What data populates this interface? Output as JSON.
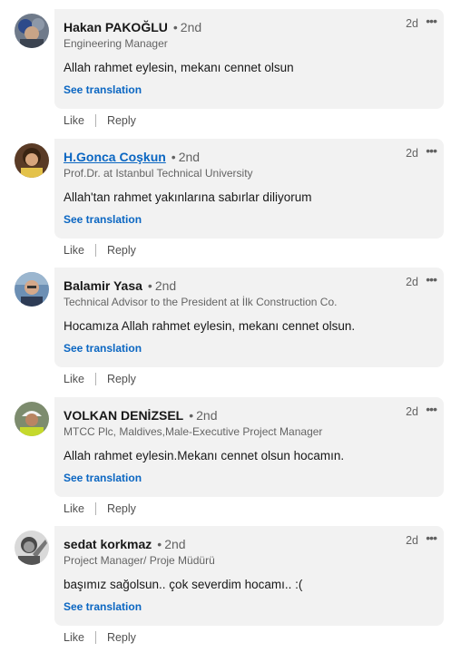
{
  "actions": {
    "like": "Like",
    "reply": "Reply"
  },
  "translate_label": "See translation",
  "more_label": "•••",
  "comments": [
    {
      "name": "Hakan PAKOĞLU",
      "degree": "2nd",
      "headline": "Engineering Manager",
      "text": "Allah rahmet eylesin, mekanı cennet olsun",
      "time": "2d"
    },
    {
      "name": "H.Gonca Coşkun",
      "degree": "2nd",
      "headline": "Prof.Dr. at Istanbul Technical University",
      "text": "Allah'tan rahmet yakınlarına sabırlar diliyorum",
      "time": "2d"
    },
    {
      "name": "Balamir Yasa",
      "degree": "2nd",
      "headline": "Technical Advisor to the President at İlk Construction Co.",
      "text": "Hocamıza Allah rahmet eylesin, mekanı cennet olsun.",
      "time": "2d"
    },
    {
      "name": "VOLKAN DENİZSEL",
      "degree": "2nd",
      "headline": "MTCC Plc, Maldives,Male-Executive Project Manager",
      "text": "Allah rahmet eylesin.Mekanı cennet olsun hocamın.",
      "time": "2d"
    },
    {
      "name": "sedat korkmaz",
      "degree": "2nd",
      "headline": "Project Manager/ Proje Müdürü",
      "text": "başımız sağolsun.. çok severdim hocamı.. :(",
      "time": "2d"
    }
  ]
}
